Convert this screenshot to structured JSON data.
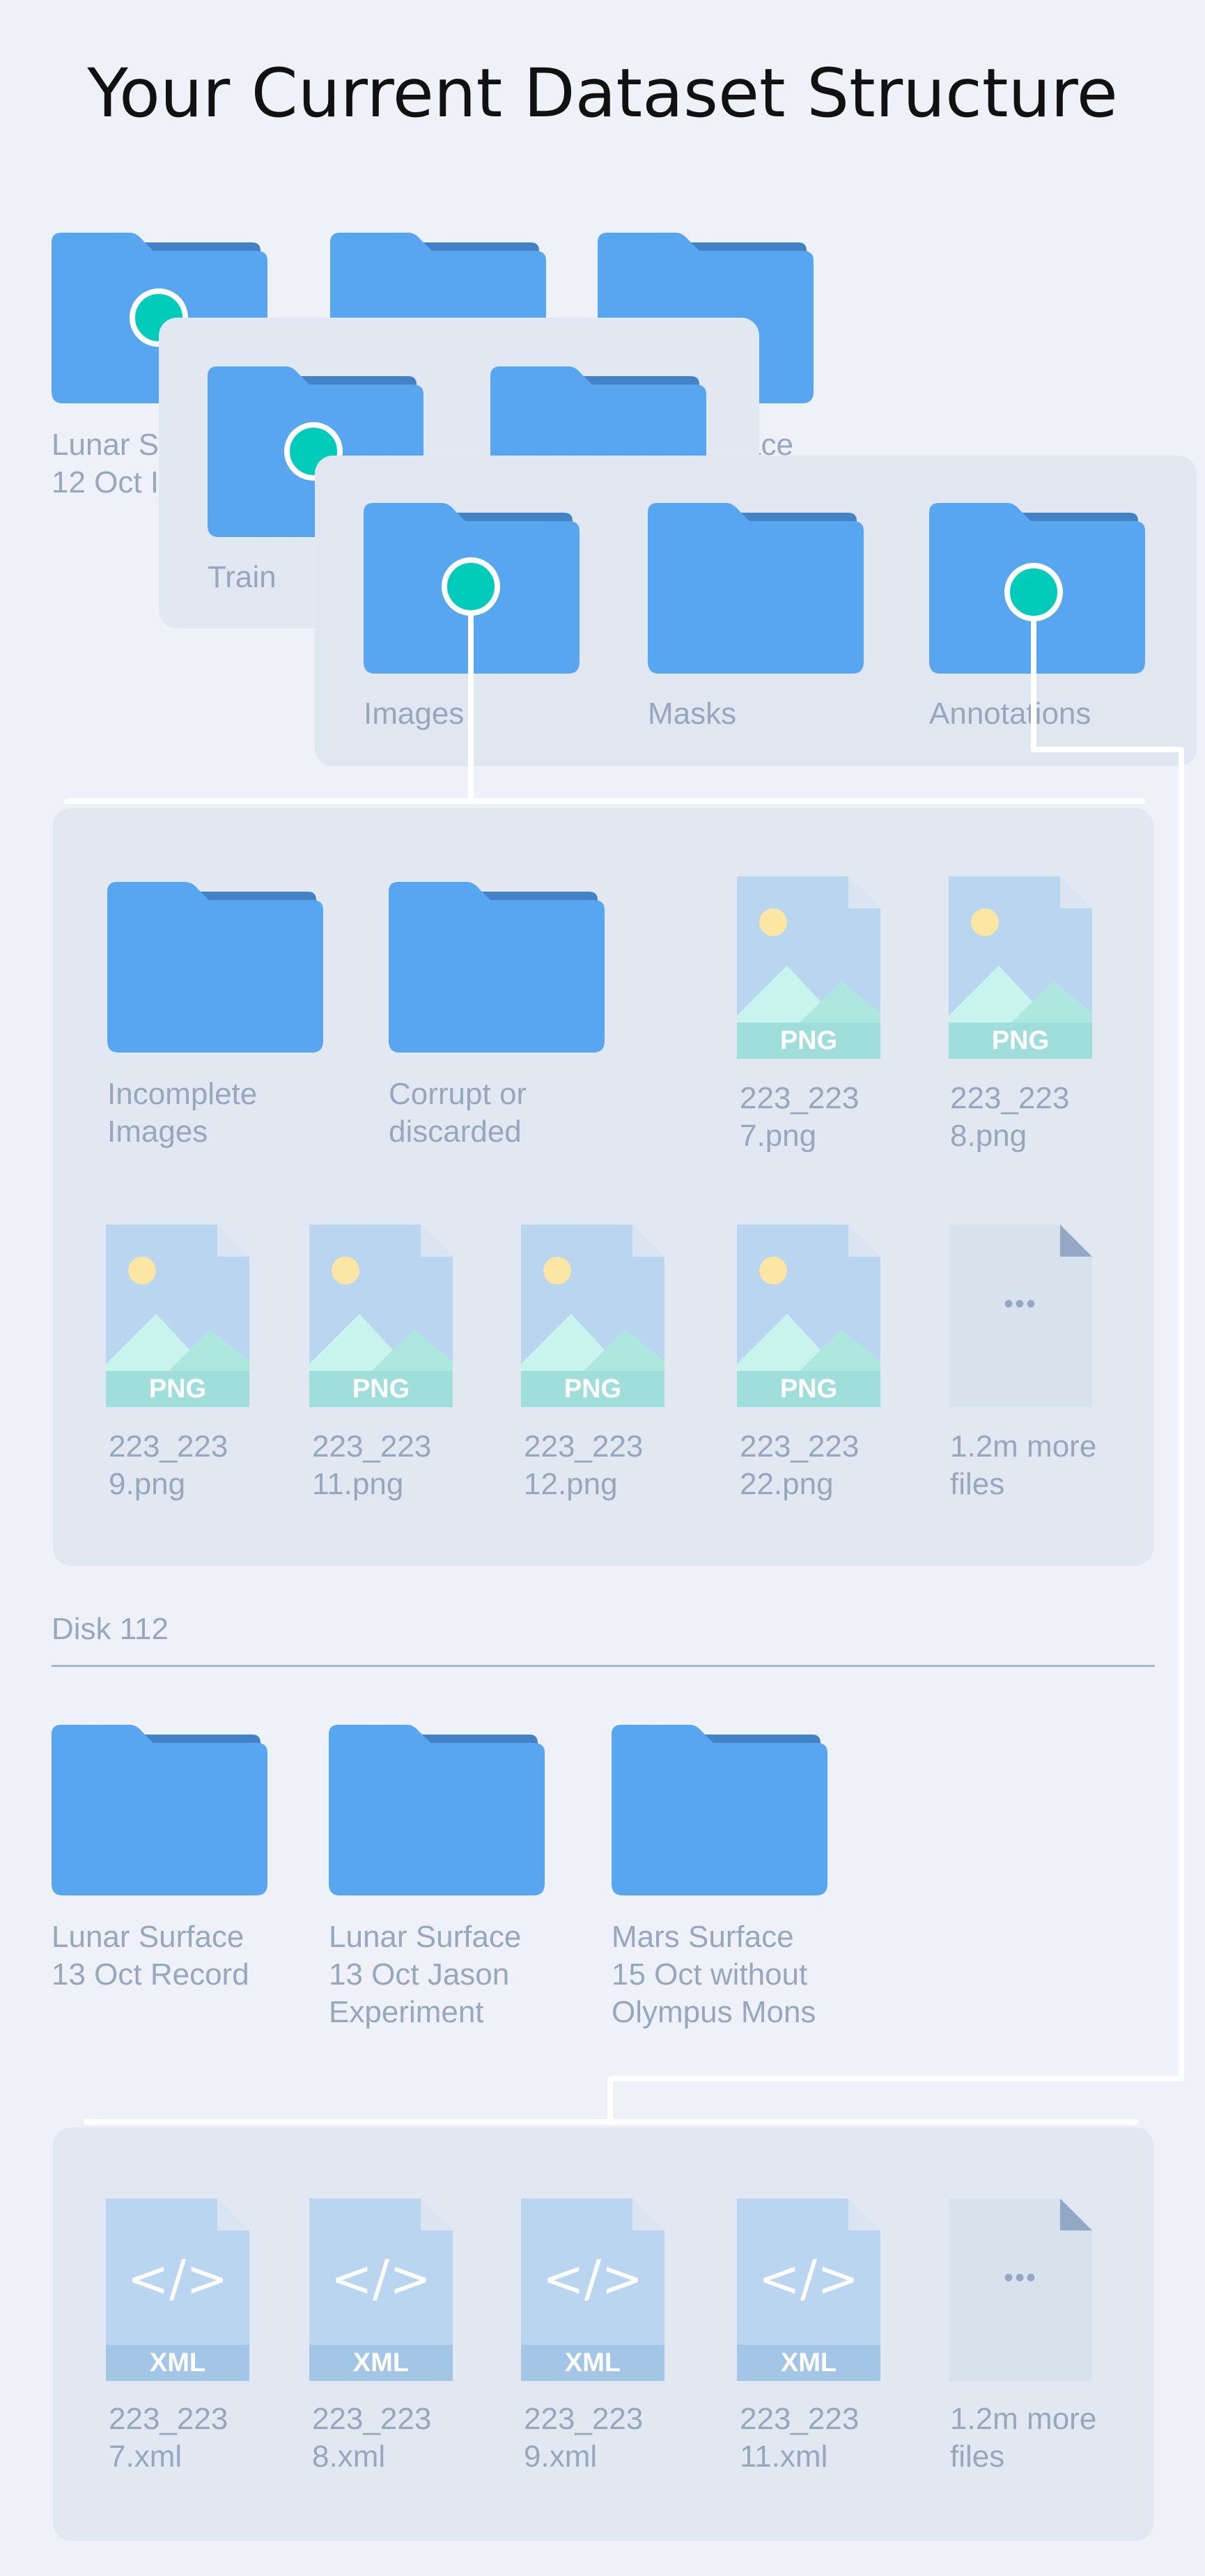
{
  "title": "Your Current Dataset Structure",
  "level1": {
    "folders": [
      {
        "label": "Lunar S\n12 Oct I"
      },
      {
        "label": ""
      },
      {
        "label": "ace"
      }
    ]
  },
  "level2": {
    "folders": [
      {
        "label": "Train"
      },
      {
        "label": ""
      }
    ]
  },
  "level3": {
    "folders": [
      {
        "label": "Images"
      },
      {
        "label": "Masks"
      },
      {
        "label": "Annotations"
      }
    ]
  },
  "images_panel": {
    "folders": [
      {
        "label": "Incomplete\nImages"
      },
      {
        "label": "Corrupt or\ndiscarded"
      }
    ],
    "files": [
      {
        "type": "PNG",
        "label": "223_223\n7.png"
      },
      {
        "type": "PNG",
        "label": "223_223\n8.png"
      },
      {
        "type": "PNG",
        "label": "223_223\n9.png"
      },
      {
        "type": "PNG",
        "label": "223_223\n11.png"
      },
      {
        "type": "PNG",
        "label": "223_223\n12.png"
      },
      {
        "type": "PNG",
        "label": "223_223\n22.png"
      }
    ],
    "more": {
      "symbol": "•••",
      "label": "1.2m more\nfiles"
    }
  },
  "disk": {
    "label": "Disk 112",
    "folders": [
      {
        "label": "Lunar Surface\n13 Oct Record"
      },
      {
        "label": "Lunar Surface\n13 Oct Jason\nExperiment"
      },
      {
        "label": "Mars Surface\n15 Oct without\nOlympus Mons"
      }
    ]
  },
  "annotations_panel": {
    "files": [
      {
        "type": "XML",
        "symbol": "</>",
        "label": "223_223\n7.xml"
      },
      {
        "type": "XML",
        "symbol": "</>",
        "label": "223_223\n8.xml"
      },
      {
        "type": "XML",
        "symbol": "</>",
        "label": "223_223\n9.xml"
      },
      {
        "type": "XML",
        "symbol": "</>",
        "label": "223_223\n11.xml"
      }
    ],
    "more": {
      "symbol": "•••",
      "label": "1.2m more\nfiles"
    }
  },
  "colors": {
    "folder_front": "#58a6ef",
    "folder_back": "#4482c6",
    "dot": "#00ccb9",
    "label": "#97a7bd"
  }
}
